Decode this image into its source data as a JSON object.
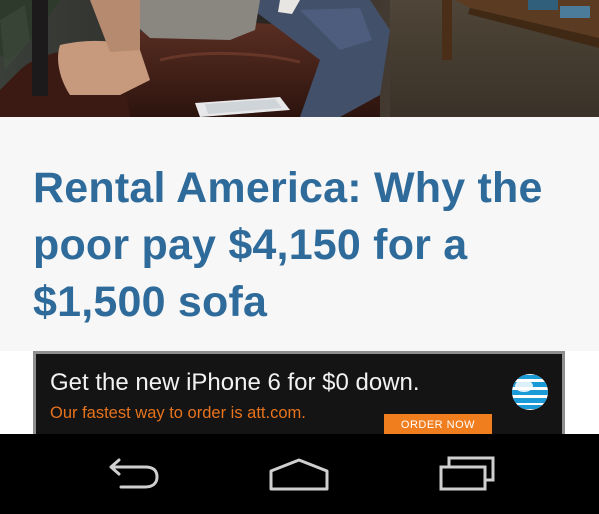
{
  "hero": {
    "icon": "article-photo-image"
  },
  "article": {
    "headline": "Rental America: Why the poor pay $4,150 for a $1,500 sofa",
    "headline_color": "#2f6b9a"
  },
  "ad": {
    "line1": "Get the new iPhone 6 for $0 down.",
    "line2": "Our fastest way to order is att.com.",
    "cta": "ORDER NOW",
    "accent_color": "#f07e1e",
    "logo_icon": "att-globe-icon"
  },
  "navbar": {
    "back_icon": "back-icon",
    "home_icon": "home-icon",
    "recent_icon": "recent-apps-icon"
  }
}
